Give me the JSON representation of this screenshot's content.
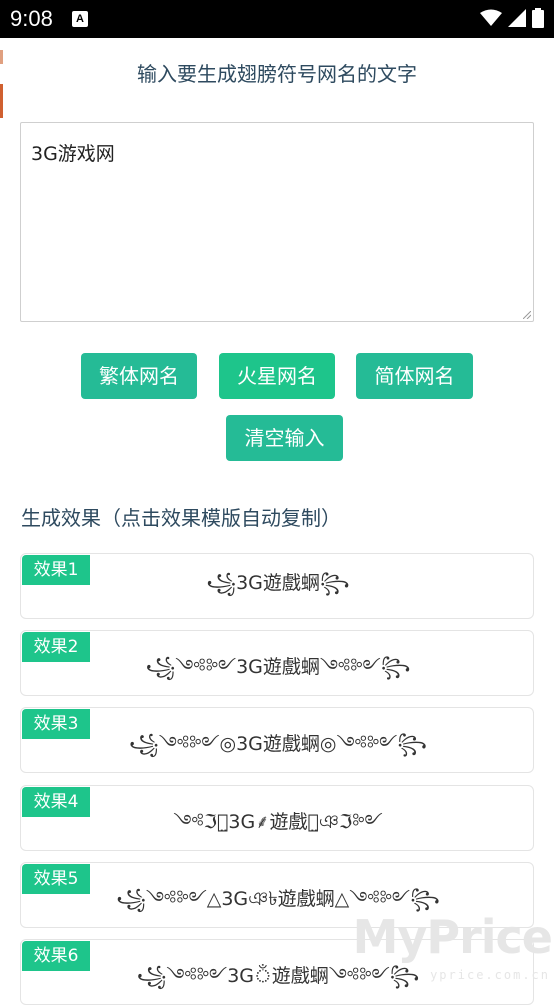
{
  "status_bar": {
    "time": "9:08",
    "app_icon_letter": "A"
  },
  "heading": "输入要生成翅膀符号网名的文字",
  "input": {
    "value": "3G游戏网"
  },
  "buttons": {
    "traditional": "繁体网名",
    "martian": "火星网名",
    "simplified": "简体网名",
    "clear": "清空输入"
  },
  "results_heading": "生成效果（点击效果模版自动复制）",
  "results": [
    {
      "label": "效果1",
      "text": "꧁3G遊戲蛧꧂"
    },
    {
      "label": "效果2",
      "text": "꧁༺༻3G遊戲蛧༺༻꧂"
    },
    {
      "label": "效果3",
      "text": "꧁༺༻◎3G遊戲蛧◎༺༻꧂"
    },
    {
      "label": "效果4",
      "text": "༺ℑঞ̤3G⸙遊戲蛧̤ঞℑ༻"
    },
    {
      "label": "效果5",
      "text": "꧁༺༻△3Gঞ৳遊戲蛧△༺༻꧂"
    },
    {
      "label": "效果6",
      "text": "꧁༺༻3Gঁ遊戲蛧༺༻꧂"
    }
  ],
  "watermark": {
    "brand": "MyPrice",
    "domain": "yprice.com.cn"
  }
}
